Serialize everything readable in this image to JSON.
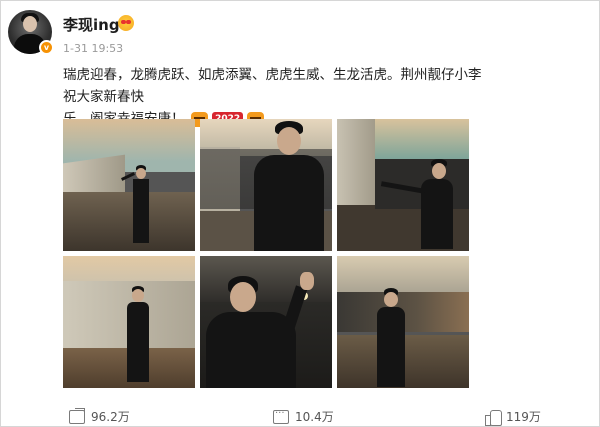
{
  "post": {
    "author": "李现ing",
    "timestamp": "1-31 19:53",
    "text_line1": "瑞虎迎春，龙腾虎跃、如虎添翼、虎虎生威、生龙活虎。荆州靓仔小李祝大家新春快",
    "text_line2": "乐，阖家幸福安康！",
    "year_badge": "2022",
    "verified_badge": "v",
    "photos": [
      {
        "alt": "photo-1"
      },
      {
        "alt": "photo-2"
      },
      {
        "alt": "photo-3"
      },
      {
        "alt": "photo-4"
      },
      {
        "alt": "photo-5"
      },
      {
        "alt": "photo-6"
      }
    ]
  },
  "actions": {
    "share_count": "96.2万",
    "comment_count": "10.4万",
    "like_count": "119万"
  },
  "colors": {
    "verified_badge": "#f69204",
    "text": "#222222",
    "muted": "#9a9a9a"
  },
  "icons": [
    "share-icon",
    "comment-icon",
    "like-icon",
    "verified-icon",
    "heart-eyes-emoji",
    "tiger-emoji"
  ]
}
